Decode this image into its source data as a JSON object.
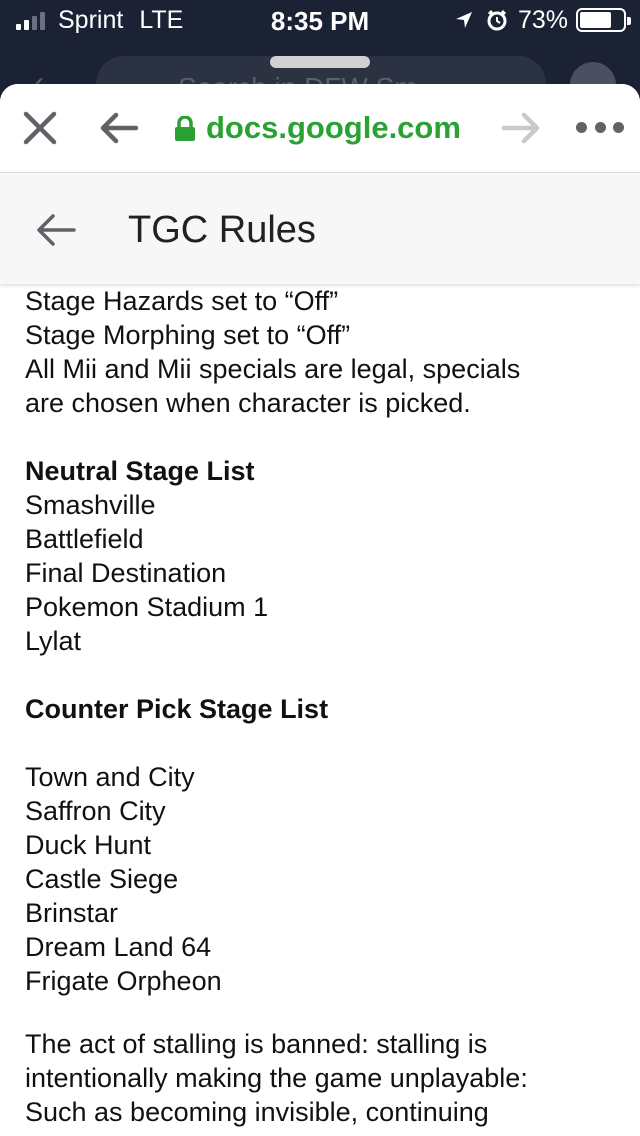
{
  "status_bar": {
    "carrier": "Sprint",
    "network": "LTE",
    "time": "8:35 PM",
    "battery": "73%",
    "battery_level": 0.73
  },
  "behind": {
    "search_placeholder": "Search in DFW Sm"
  },
  "browser": {
    "url": "docs.google.com",
    "icons": [
      "close-icon",
      "back-arrow-icon",
      "lock-icon",
      "forward-arrow-icon",
      "more-dots-icon"
    ],
    "accent_color": "#2aa133"
  },
  "doc": {
    "title": "TGC Rules",
    "rules": [
      "Stage Hazards set to “Off”",
      "Stage Morphing set to “Off”",
      "All Mii and Mii specials are legal, specials",
      "are chosen when character is picked."
    ],
    "neutral_heading": "Neutral Stage List",
    "neutral_stages": [
      "Smashville",
      "Battlefield",
      "Final Destination",
      "Pokemon Stadium 1",
      "Lylat"
    ],
    "counter_heading": "Counter Pick Stage List",
    "counter_stages": [
      "Town and City",
      "Saffron City",
      "Duck Hunt",
      "Castle Siege",
      "Brinstar",
      "Dream Land 64",
      "Frigate Orpheon"
    ],
    "stalling": [
      "The act of stalling is banned: stalling is",
      "intentionally making the game unplayable:",
      "Such as becoming invisible, continuing"
    ]
  }
}
